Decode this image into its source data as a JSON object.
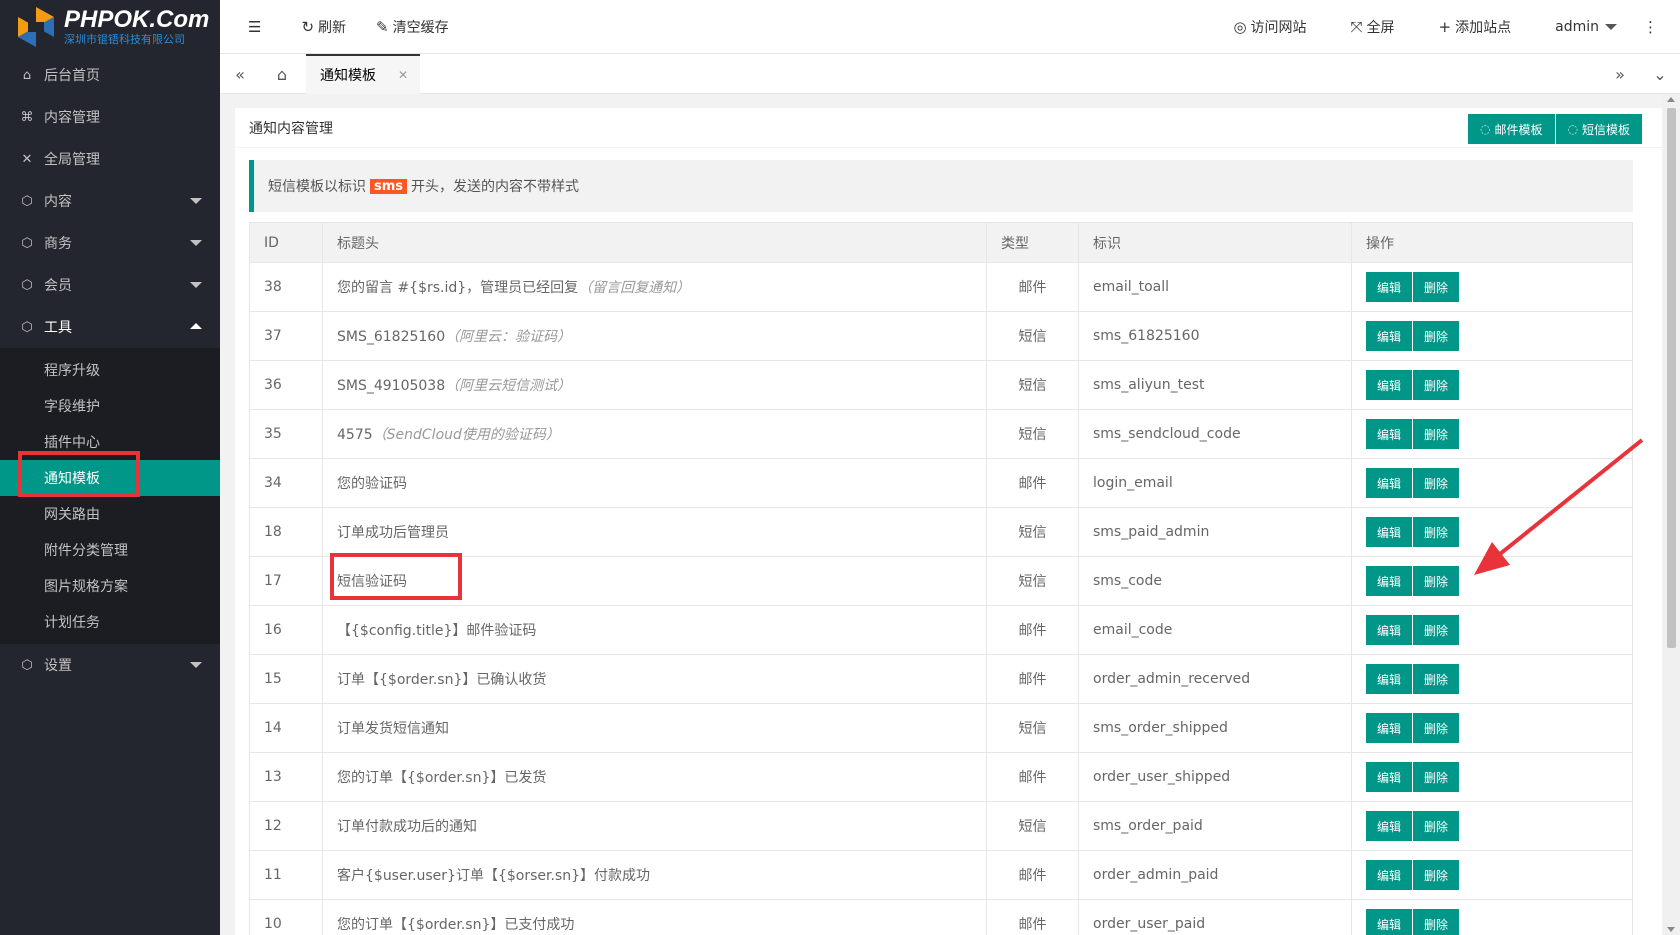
{
  "brand": {
    "title": "PHPOK.Com",
    "subtitle": "深圳市锟铻科技有限公司"
  },
  "sidebar": {
    "items": [
      {
        "label": "后台首页",
        "icon": "home-icon"
      },
      {
        "label": "内容管理",
        "icon": "content-icon"
      },
      {
        "label": "全局管理",
        "icon": "global-icon"
      },
      {
        "label": "内容",
        "icon": "cube-icon"
      },
      {
        "label": "商务",
        "icon": "cube-icon"
      },
      {
        "label": "会员",
        "icon": "cube-icon"
      },
      {
        "label": "工具",
        "icon": "cube-icon"
      }
    ],
    "tools_sub": [
      "程序升级",
      "字段维护",
      "插件中心",
      "通知模板",
      "网关路由",
      "附件分类管理",
      "图片规格方案",
      "计划任务"
    ],
    "settings": {
      "label": "设置",
      "icon": "cube-icon"
    }
  },
  "topbar": {
    "refresh": "刷新",
    "clear_cache": "清空缓存",
    "visit_site": "访问网站",
    "fullscreen": "全屏",
    "add_site": "添加站点",
    "user": "admin"
  },
  "tabbar": {
    "active_tab": "通知模板"
  },
  "card": {
    "title": "通知内容管理",
    "btn_email": "邮件模板",
    "btn_sms": "短信模板"
  },
  "notice": {
    "prefix": "短信模板以标识",
    "tag": "sms",
    "suffix": "开头，发送的内容不带样式"
  },
  "table": {
    "headers": [
      "ID",
      "标题头",
      "类型",
      "标识",
      "操作"
    ],
    "edit_label": "编辑",
    "delete_label": "删除",
    "rows": [
      {
        "id": "38",
        "title": "您的留言 #{$rs.id}，管理员已经回复",
        "note": "（留言回复通知）",
        "type": "邮件",
        "code": "email_toall"
      },
      {
        "id": "37",
        "title": "SMS_61825160",
        "note": "（阿里云：验证码）",
        "type": "短信",
        "code": "sms_61825160"
      },
      {
        "id": "36",
        "title": "SMS_49105038",
        "note": "（阿里云短信测试）",
        "type": "短信",
        "code": "sms_aliyun_test"
      },
      {
        "id": "35",
        "title": "4575",
        "note": "（SendCloud使用的验证码）",
        "type": "短信",
        "code": "sms_sendcloud_code"
      },
      {
        "id": "34",
        "title": "您的验证码",
        "note": "",
        "type": "邮件",
        "code": "login_email"
      },
      {
        "id": "18",
        "title": "订单成功后管理员",
        "note": "",
        "type": "短信",
        "code": "sms_paid_admin"
      },
      {
        "id": "17",
        "title": "短信验证码",
        "note": "",
        "type": "短信",
        "code": "sms_code"
      },
      {
        "id": "16",
        "title": "【{$config.title}】邮件验证码",
        "note": "",
        "type": "邮件",
        "code": "email_code"
      },
      {
        "id": "15",
        "title": "订单【{$order.sn}】已确认收货",
        "note": "",
        "type": "邮件",
        "code": "order_admin_recerved"
      },
      {
        "id": "14",
        "title": "订单发货短信通知",
        "note": "",
        "type": "短信",
        "code": "sms_order_shipped"
      },
      {
        "id": "13",
        "title": "您的订单【{$order.sn}】已发货",
        "note": "",
        "type": "邮件",
        "code": "order_user_shipped"
      },
      {
        "id": "12",
        "title": "订单付款成功后的通知",
        "note": "",
        "type": "短信",
        "code": "sms_order_paid"
      },
      {
        "id": "11",
        "title": "客户{$user.user}订单【{$orser.sn}】付款成功",
        "note": "",
        "type": "邮件",
        "code": "order_admin_paid"
      },
      {
        "id": "10",
        "title": "您的订单【{$order.sn}】已支付成功",
        "note": "",
        "type": "邮件",
        "code": "order_user_paid"
      }
    ]
  },
  "colors": {
    "accent": "#009688",
    "sidebar_bg": "#23262e",
    "highlight": "#e8333a",
    "tag": "#ff5722"
  }
}
